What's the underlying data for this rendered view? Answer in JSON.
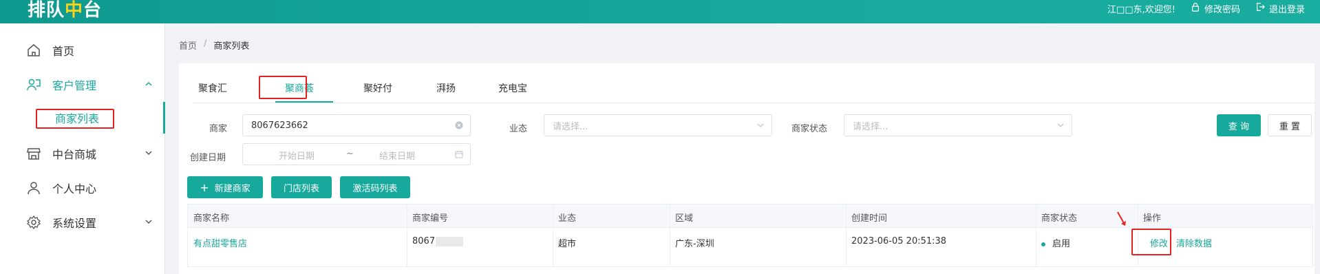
{
  "header": {
    "logo_part1": "排队",
    "logo_part2": "中",
    "logo_part3": "台",
    "welcome": "江□□东,欢迎您!",
    "change_password": "修改密码",
    "logout": "退出登录"
  },
  "sidebar": {
    "items": [
      {
        "label": "首页",
        "icon": "home-icon"
      },
      {
        "label": "客户管理",
        "icon": "customer-icon",
        "expanded": true
      },
      {
        "label": "中台商城",
        "icon": "store-icon"
      },
      {
        "label": "个人中心",
        "icon": "user-icon"
      },
      {
        "label": "系统设置",
        "icon": "gear-icon"
      }
    ],
    "subitem": "商家列表"
  },
  "breadcrumb": {
    "home": "首页",
    "sep": "/",
    "current": "商家列表"
  },
  "tabs": [
    "聚食汇",
    "聚商荟",
    "聚好付",
    "湃扬",
    "充电宝"
  ],
  "active_tab": "聚商荟",
  "filters": {
    "merchant_label": "商家",
    "merchant_value": "8067623662",
    "business_label": "业态",
    "business_placeholder": "请选择...",
    "status_label": "商家状态",
    "status_placeholder": "请选择...",
    "date_label": "创建日期",
    "date_start_placeholder": "开始日期",
    "date_sep": "~",
    "date_end_placeholder": "结束日期",
    "query_button": "查 询",
    "reset_button": "重 置"
  },
  "actions": {
    "new_merchant": "新建商家",
    "store_list": "门店列表",
    "activation_code_list": "激活码列表"
  },
  "table": {
    "columns": [
      "商家名称",
      "商家编号",
      "业态",
      "区域",
      "创建时间",
      "商家状态",
      "操作"
    ],
    "rows": [
      {
        "name": "有点甜零售店",
        "number_visible": "8067",
        "business": "超市",
        "region": "广东-深圳",
        "created": "2023-06-05 20:51:38",
        "status": "启用",
        "edit": "修改",
        "clear": "清除数据"
      }
    ]
  },
  "colors": {
    "accent": "#17a99c",
    "annotation": "#e5201f",
    "logo_highlight": "#f7d21a"
  }
}
